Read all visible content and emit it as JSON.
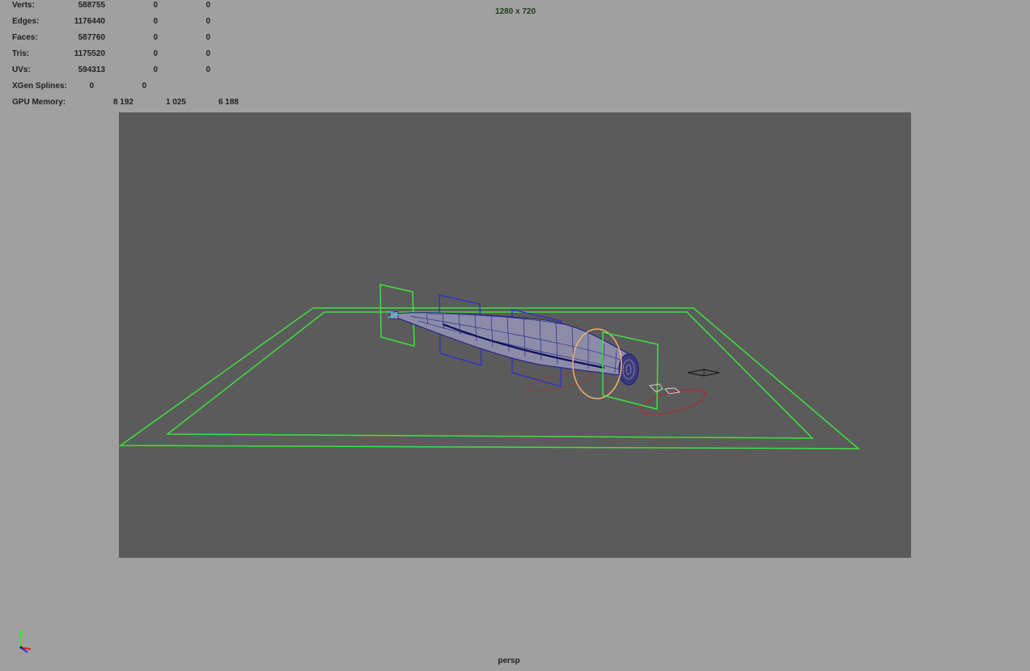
{
  "hud": {
    "rows": [
      {
        "label": "Verts:",
        "v1": "588755",
        "v2": "0",
        "v3": "0"
      },
      {
        "label": "Edges:",
        "v1": "1176440",
        "v2": "0",
        "v3": "0"
      },
      {
        "label": "Faces:",
        "v1": "587760",
        "v2": "0",
        "v3": "0"
      },
      {
        "label": "Tris:",
        "v1": "1175520",
        "v2": "0",
        "v3": "0"
      },
      {
        "label": "UVs:",
        "v1": "594313",
        "v2": "0",
        "v3": "0"
      }
    ],
    "xgen": {
      "label": "XGen Splines:",
      "v1": "0",
      "v2": "0"
    },
    "gpu": {
      "label": "GPU Memory:",
      "v1": "8 192",
      "v2": "1 025",
      "v3": "6 188"
    }
  },
  "viewport": {
    "resolution": "1280 x 720",
    "camera": "persp"
  },
  "colors": {
    "background": "#a0a0a0",
    "viewport": "#5b5b5b",
    "control_green": "#3ee03e",
    "control_blue": "#2b2bd6",
    "mesh_blue": "#1c1c8c",
    "mesh_fill": "#8c8ca8",
    "ring_orange": "#f0b070",
    "ring_red": "#c02020"
  },
  "icons": {
    "axis": "xyz-axis-gizmo-icon"
  }
}
